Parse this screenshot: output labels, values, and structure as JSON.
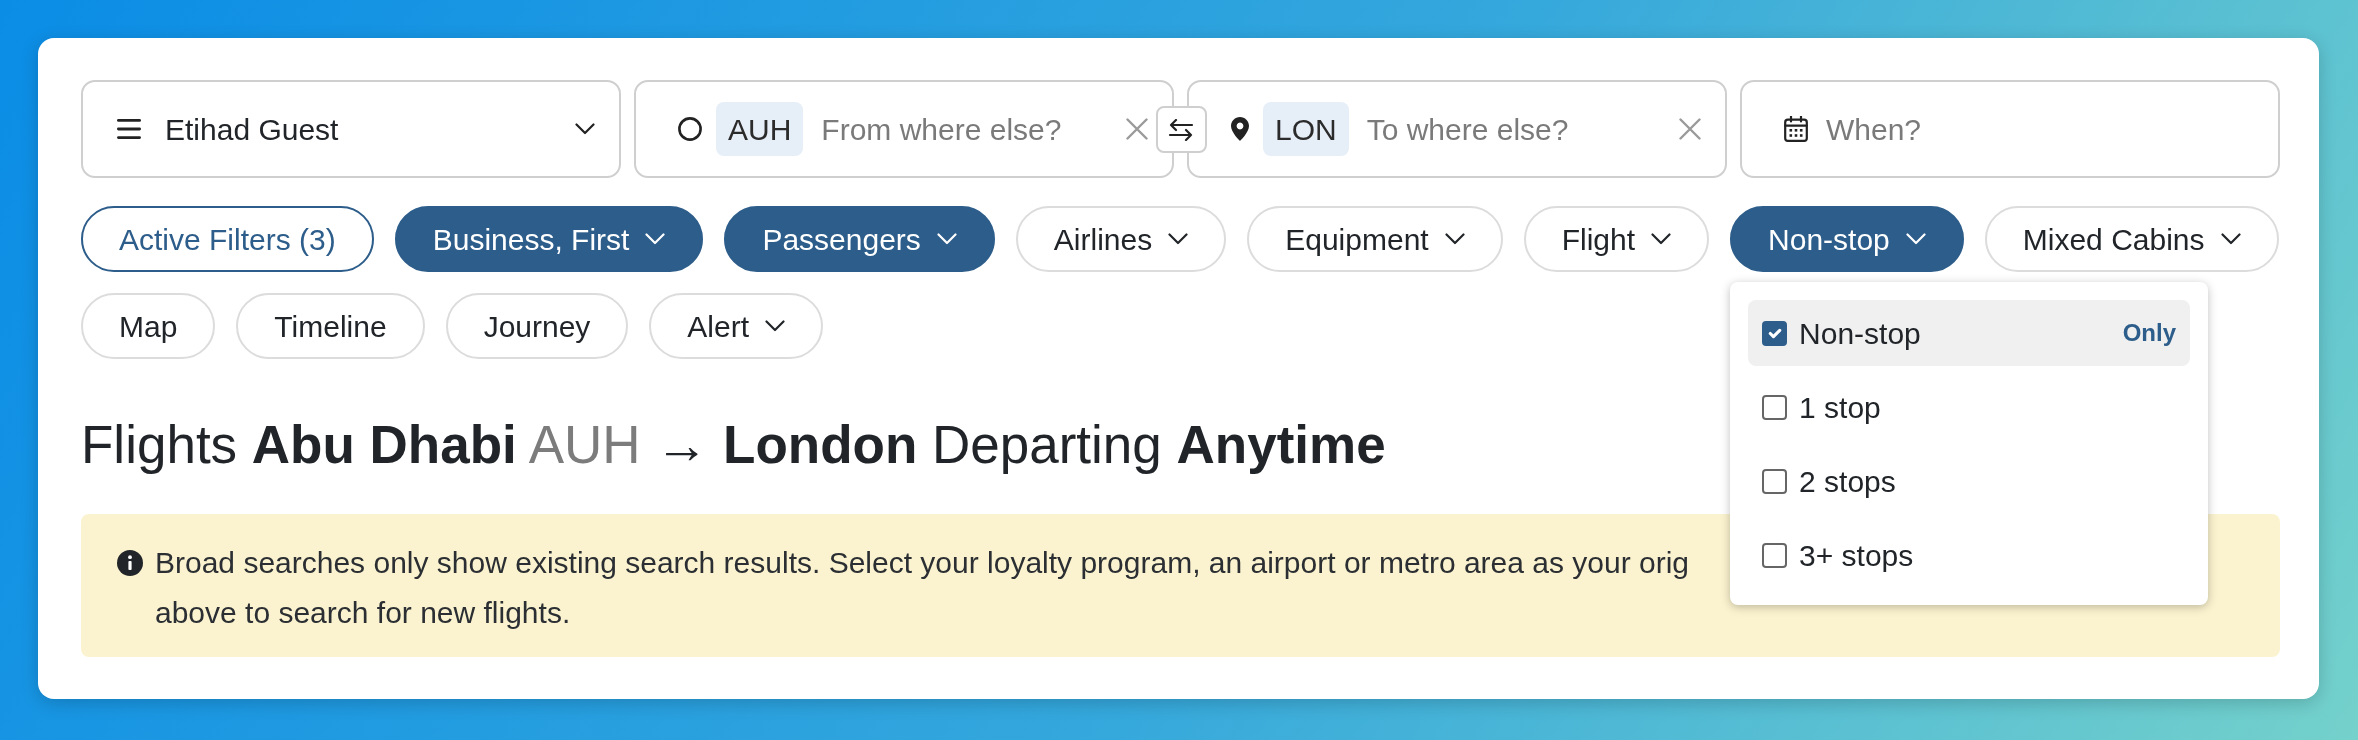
{
  "search_bar": {
    "program": {
      "label": "Etihad Guest"
    },
    "origin": {
      "code": "AUH",
      "placeholder": "From where else?"
    },
    "destination": {
      "code": "LON",
      "placeholder": "To where else?"
    },
    "date": {
      "placeholder": "When?"
    }
  },
  "filters": [
    {
      "label": "Active Filters (3)",
      "kind": "summary",
      "active": false,
      "caret": false
    },
    {
      "label": "Business, First",
      "kind": "filter",
      "active": true,
      "caret": true
    },
    {
      "label": "Passengers",
      "kind": "filter",
      "active": true,
      "caret": true
    },
    {
      "label": "Airlines",
      "kind": "filter",
      "active": false,
      "caret": true
    },
    {
      "label": "Equipment",
      "kind": "filter",
      "active": false,
      "caret": true
    },
    {
      "label": "Flight",
      "kind": "filter",
      "active": false,
      "caret": true
    },
    {
      "label": "Non-stop",
      "kind": "filter",
      "active": true,
      "caret": true,
      "menu": {
        "options": [
          {
            "label": "Non-stop",
            "checked": true,
            "hovered": true,
            "action": "Only"
          },
          {
            "label": "1 stop",
            "checked": false,
            "hovered": false
          },
          {
            "label": "2 stops",
            "checked": false,
            "hovered": false
          },
          {
            "label": "3+ stops",
            "checked": false,
            "hovered": false
          }
        ]
      }
    },
    {
      "label": "Mixed Cabins",
      "kind": "filter",
      "active": false,
      "caret": true
    }
  ],
  "views": [
    {
      "label": "Map",
      "active": false,
      "caret": false
    },
    {
      "label": "Timeline",
      "active": false,
      "caret": false
    },
    {
      "label": "Journey",
      "active": false,
      "caret": false
    },
    {
      "label": "Alert",
      "active": false,
      "caret": true
    }
  ],
  "heading": {
    "parts": [
      {
        "text": "Flights",
        "kind": "word"
      },
      {
        "text": "Abu Dhabi",
        "kind": "place"
      },
      {
        "text": "AUH",
        "kind": "code"
      },
      {
        "text": "→",
        "kind": "word"
      },
      {
        "text": "London",
        "kind": "place"
      },
      {
        "text": "Departing",
        "kind": "word"
      },
      {
        "text": "Anytime",
        "kind": "time"
      }
    ]
  },
  "alert": {
    "lines": [
      "Broad searches only show existing search results. Select your loyalty program, an airport or metro area as your orig",
      "above to search for new flights."
    ]
  }
}
